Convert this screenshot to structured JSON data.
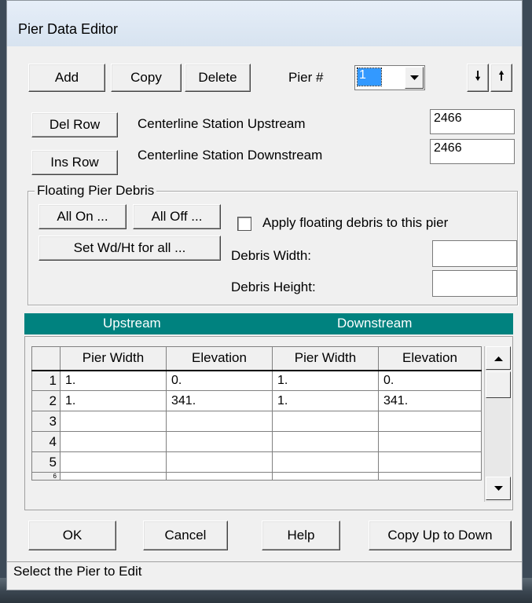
{
  "window": {
    "title": "Pier Data Editor"
  },
  "toolbar": {
    "add_label": "Add",
    "copy_label": "Copy",
    "delete_label": "Delete",
    "pier_label": "Pier #",
    "pier_selected": "1",
    "down_arrow": "🠗",
    "up_arrow": "🠕"
  },
  "rows": {
    "del_row_label": "Del Row",
    "ins_row_label": "Ins Row"
  },
  "centerline": {
    "upstream_label": "Centerline Station Upstream",
    "upstream_value": "2466",
    "downstream_label": "Centerline Station Downstream",
    "downstream_value": "2466"
  },
  "debris": {
    "group_title": "Floating Pier Debris",
    "all_on_label": "All On ...",
    "all_off_label": "All Off ...",
    "set_wd_ht_label": "Set Wd/Ht for all ...",
    "apply_label": "Apply floating debris to this pier",
    "apply_checked": false,
    "width_label": "Debris Width:",
    "width_value": "",
    "height_label": "Debris Height:",
    "height_value": ""
  },
  "grid": {
    "upstream_header": "Upstream",
    "downstream_header": "Downstream",
    "columns": [
      "Pier Width",
      "Elevation",
      "Pier Width",
      "Elevation"
    ],
    "rows": [
      {
        "num": "1",
        "cells": [
          "1.",
          "0.",
          "1.",
          "0."
        ]
      },
      {
        "num": "2",
        "cells": [
          "1.",
          "341.",
          "1.",
          "341."
        ]
      },
      {
        "num": "3",
        "cells": [
          "",
          "",
          "",
          ""
        ]
      },
      {
        "num": "4",
        "cells": [
          "",
          "",
          "",
          ""
        ]
      },
      {
        "num": "5",
        "cells": [
          "",
          "",
          "",
          ""
        ]
      },
      {
        "num": "6",
        "cells": [
          "",
          "",
          "",
          ""
        ]
      }
    ]
  },
  "buttons": {
    "ok_label": "OK",
    "cancel_label": "Cancel",
    "help_label": "Help",
    "copy_up_down_label": "Copy Up to Down"
  },
  "status": {
    "text": "Select the Pier to Edit"
  }
}
